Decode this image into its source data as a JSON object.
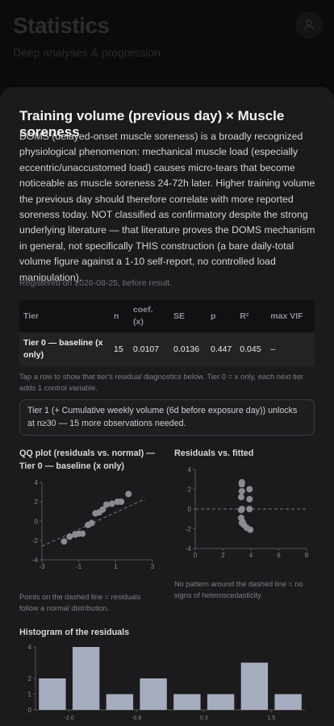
{
  "header": {
    "title": "Statistics",
    "subtitle": "Deep analyses & progression",
    "avatar_icon": "user-icon"
  },
  "card": {
    "title": "Training volume (previous day) × Muscle soreness",
    "description": "DOMS (delayed-onset muscle soreness) is a broadly recognized physiological phenomenon: mechanical muscle load (especially eccentric/unaccustomed load) causes micro-tears that become noticeable as muscle soreness 24-72h later. Higher training volume the previous day should therefore correlate with more reported soreness today. NOT classified as confirmatory despite the strong underlying literature — that literature proves the DOMS mechanism in general, not specifically THIS construction (a bare daily-total volume figure against a 1-10 self-report, no controlled load manipulation).",
    "registered": "Registered on 2026-08-25, before result.",
    "table": {
      "headers": [
        "Tier",
        "n",
        "coef. (x)",
        "SE",
        "p",
        "R²",
        "max VIF"
      ],
      "rows": [
        {
          "tier": "Tier 0 — baseline (x only)",
          "n": "15",
          "coef": "0.0107",
          "se": "0.0136",
          "p": "0.447",
          "r2": "0.045",
          "vif": "–"
        }
      ]
    },
    "hint": "Tap a row to show that tier's residual diagnostics below. Tier 0 = x only, each next tier adds 1 control variable.",
    "unlock": "Tier 1 (+ Cumulative weekly volume (6d before exposure day)) unlocks at n≥30 — 15 more observations needed.",
    "qq_title": "QQ plot (residuals vs. normal) — Tier 0 — baseline (x only)",
    "qq_note": "Points on the dashed line = residuals follow a normal distribution.",
    "rf_title": "Residuals vs. fitted",
    "rf_note": "No pattern around the dashed line = no signs of heteroscedasticity.",
    "hist_title": "Histogram of the residuals"
  },
  "chart_data": [
    {
      "type": "scatter",
      "x_ticks": [
        "-3",
        "-1",
        "1",
        "3"
      ],
      "y_ticks": [
        "-4",
        "-2",
        "0",
        "2",
        "4"
      ],
      "xlim": [
        -3,
        3
      ],
      "ylim": [
        -4,
        4
      ],
      "reference_line": "dashed",
      "points": [
        {
          "x": -1.8,
          "y": -2.1
        },
        {
          "x": -1.5,
          "y": -1.6
        },
        {
          "x": -1.2,
          "y": -1.4
        },
        {
          "x": -1.0,
          "y": -1.3
        },
        {
          "x": -0.8,
          "y": -1.3
        },
        {
          "x": -0.5,
          "y": -0.4
        },
        {
          "x": -0.3,
          "y": -0.2
        },
        {
          "x": -0.1,
          "y": 0.8
        },
        {
          "x": 0.1,
          "y": 0.9
        },
        {
          "x": 0.3,
          "y": 1.2
        },
        {
          "x": 0.5,
          "y": 1.7
        },
        {
          "x": 0.8,
          "y": 1.8
        },
        {
          "x": 1.1,
          "y": 2.0
        },
        {
          "x": 1.3,
          "y": 2.0
        },
        {
          "x": 1.7,
          "y": 2.8
        }
      ]
    },
    {
      "type": "scatter",
      "x_ticks": [
        "0",
        "2",
        "4",
        "6",
        "8"
      ],
      "y_ticks": [
        "-4",
        "-2",
        "0",
        "2",
        "4"
      ],
      "xlim": [
        0,
        8
      ],
      "ylim": [
        -4,
        4
      ],
      "reference_line": "dashed",
      "points": [
        {
          "x": 3.35,
          "y": 2.7
        },
        {
          "x": 3.35,
          "y": 1.8
        },
        {
          "x": 3.3,
          "y": 1.2
        },
        {
          "x": 3.35,
          "y": 0.0
        },
        {
          "x": 3.3,
          "y": -0.1
        },
        {
          "x": 3.3,
          "y": -0.9
        },
        {
          "x": 3.35,
          "y": -1.4
        },
        {
          "x": 3.5,
          "y": -1.6
        },
        {
          "x": 3.7,
          "y": -1.9
        },
        {
          "x": 3.9,
          "y": 2.0
        },
        {
          "x": 3.9,
          "y": 1.0
        },
        {
          "x": 3.9,
          "y": 0.0
        },
        {
          "x": 3.95,
          "y": -2.1
        },
        {
          "x": 3.35,
          "y": 2.5
        },
        {
          "x": 3.4,
          "y": -1.3
        }
      ]
    },
    {
      "type": "bar",
      "title": "Histogram of the residuals",
      "x_ticks": [
        "-2.0",
        "-0.8",
        "0.3",
        "1.5"
      ],
      "y_ticks": [
        "0",
        "1",
        "2",
        "4"
      ],
      "ylim": [
        0,
        4
      ],
      "values": [
        2,
        4,
        1,
        2,
        1,
        1,
        3,
        1
      ]
    }
  ]
}
